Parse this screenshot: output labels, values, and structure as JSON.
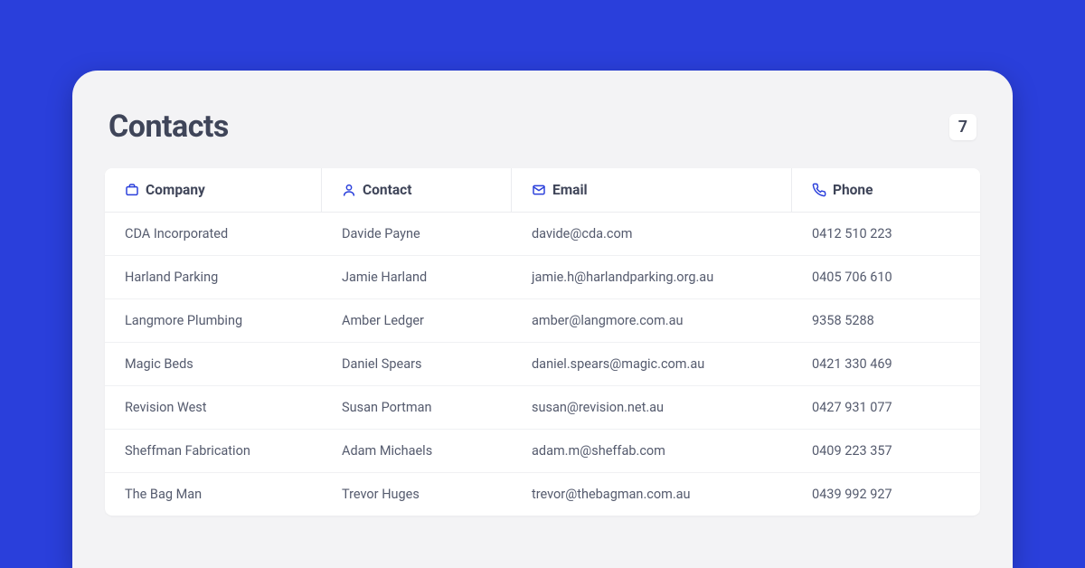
{
  "page": {
    "title": "Contacts",
    "count": "7"
  },
  "columns": {
    "company": "Company",
    "contact": "Contact",
    "email": "Email",
    "phone": "Phone"
  },
  "rows": [
    {
      "company": "CDA Incorporated",
      "contact": "Davide Payne",
      "email": "davide@cda.com",
      "phone": "0412 510 223"
    },
    {
      "company": "Harland Parking",
      "contact": "Jamie Harland",
      "email": "jamie.h@harlandparking.org.au",
      "phone": "0405 706 610"
    },
    {
      "company": "Langmore Plumbing",
      "contact": "Amber Ledger",
      "email": "amber@langmore.com.au",
      "phone": "9358 5288"
    },
    {
      "company": "Magic Beds",
      "contact": "Daniel Spears",
      "email": "daniel.spears@magic.com.au",
      "phone": "0421 330 469"
    },
    {
      "company": "Revision West",
      "contact": "Susan Portman",
      "email": "susan@revision.net.au",
      "phone": "0427 931 077"
    },
    {
      "company": "Sheffman Fabrication",
      "contact": "Adam Michaels",
      "email": "adam.m@sheffab.com",
      "phone": "0409 223 357"
    },
    {
      "company": "The Bag Man",
      "contact": "Trevor Huges",
      "email": "trevor@thebagman.com.au",
      "phone": "0439 992 927"
    }
  ]
}
